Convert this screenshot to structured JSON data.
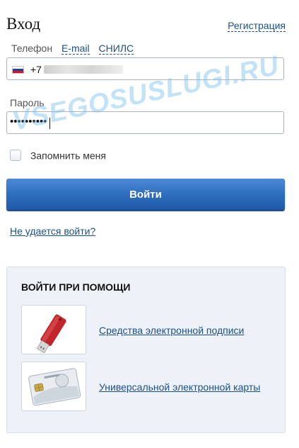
{
  "header": {
    "title": "Вход",
    "register_link": "Регистрация"
  },
  "login_tabs": [
    {
      "label": "Телефон",
      "active": true
    },
    {
      "label": "E-mail",
      "active": false
    },
    {
      "label": "СНИЛС",
      "active": false
    }
  ],
  "phone": {
    "country": "Russia",
    "flag_icon": "russia-flag-icon",
    "code": "+7"
  },
  "password": {
    "label": "Пароль",
    "value": "••••••••••"
  },
  "watermark": "VSEGOSUSLUGI.RU",
  "remember": {
    "label": "Запомнить меня",
    "checked": false
  },
  "login_button": {
    "label": "Войти"
  },
  "forgot_link": "Не удается войти?",
  "alt_login": {
    "title": "ВОЙТИ ПРИ ПОМОЩИ",
    "items": [
      {
        "icon": "usb-token-icon",
        "label": "Средства электронной подписи"
      },
      {
        "icon": "smart-card-icon",
        "label": "Универсальной электронной карты"
      }
    ]
  },
  "colors": {
    "link": "#1b4f8c",
    "button": "#2f6fbf",
    "panel_bg": "#eef2f8"
  }
}
